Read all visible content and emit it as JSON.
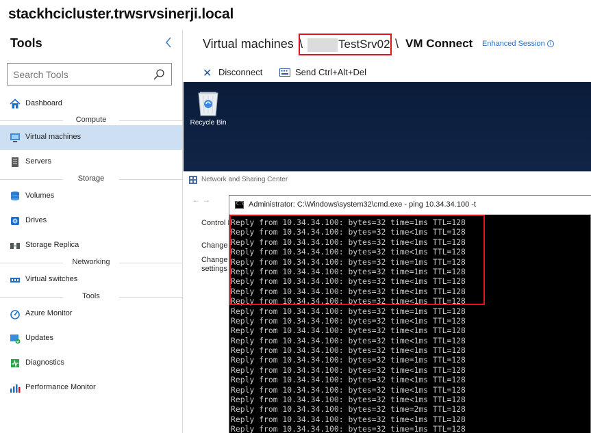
{
  "window": {
    "title": "stackhcicluster.trwsrvsinerji.local"
  },
  "sidebar": {
    "title": "Tools",
    "search_placeholder": "Search Tools",
    "sections": {
      "compute": "Compute",
      "storage": "Storage",
      "networking": "Networking",
      "tools": "Tools"
    },
    "items": {
      "dashboard": "Dashboard",
      "virtual_machines": "Virtual machines",
      "servers": "Servers",
      "volumes": "Volumes",
      "drives": "Drives",
      "storage_replica": "Storage Replica",
      "virtual_switches": "Virtual switches",
      "azure_monitor": "Azure Monitor",
      "updates": "Updates",
      "diagnostics": "Diagnostics",
      "performance_monitor": "Performance Monitor"
    },
    "active_item": "Virtual machines"
  },
  "breadcrumb": {
    "root": "Virtual machines",
    "sep": "\\",
    "host": "TestSrv02",
    "current": "VM Connect",
    "enhanced_session": "Enhanced Session",
    "info_glyph": "i"
  },
  "toolbar": {
    "disconnect": "Disconnect",
    "disconnect_glyph": "✕",
    "send_cad": "Send Ctrl+Alt+Del"
  },
  "vm": {
    "recycle_bin": "Recycle Bin",
    "nsc_title": "Network and Sharing Center",
    "nsc_nav": "←  →",
    "nsc_links": {
      "control": "Control P",
      "change1": "Change",
      "change2": "Change",
      "settings": "settings"
    },
    "cmd_title": "Administrator: C:\\Windows\\system32\\cmd.exe - ping  10.34.34.100 -t",
    "ping_lines": [
      "Reply from 10.34.34.100: bytes=32 time=1ms TTL=128",
      "Reply from 10.34.34.100: bytes=32 time<1ms TTL=128",
      "Reply from 10.34.34.100: bytes=32 time<1ms TTL=128",
      "Reply from 10.34.34.100: bytes=32 time<1ms TTL=128",
      "Reply from 10.34.34.100: bytes=32 time=1ms TTL=128",
      "Reply from 10.34.34.100: bytes=32 time=1ms TTL=128",
      "Reply from 10.34.34.100: bytes=32 time<1ms TTL=128",
      "Reply from 10.34.34.100: bytes=32 time<1ms TTL=128",
      "Reply from 10.34.34.100: bytes=32 time<1ms TTL=128",
      "Reply from 10.34.34.100: bytes=32 time=1ms TTL=128",
      "Reply from 10.34.34.100: bytes=32 time<1ms TTL=128",
      "Reply from 10.34.34.100: bytes=32 time<1ms TTL=128",
      "Reply from 10.34.34.100: bytes=32 time<1ms TTL=128",
      "Reply from 10.34.34.100: bytes=32 time<1ms TTL=128",
      "Reply from 10.34.34.100: bytes=32 time=1ms TTL=128",
      "Reply from 10.34.34.100: bytes=32 time<1ms TTL=128",
      "Reply from 10.34.34.100: bytes=32 time<1ms TTL=128",
      "Reply from 10.34.34.100: bytes=32 time<1ms TTL=128",
      "Reply from 10.34.34.100: bytes=32 time<1ms TTL=128",
      "Reply from 10.34.34.100: bytes=32 time=2ms TTL=128",
      "Reply from 10.34.34.100: bytes=32 time<1ms TTL=128",
      "Reply from 10.34.34.100: bytes=32 time=1ms TTL=128"
    ]
  },
  "colors": {
    "accent": "#2a6fc1",
    "active_bg": "#cde0f3",
    "highlight": "#e0141e"
  }
}
